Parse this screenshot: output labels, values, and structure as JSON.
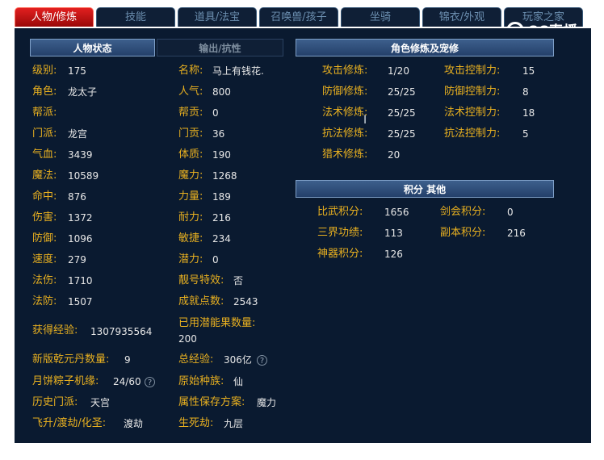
{
  "tabs": [
    "人物/修炼",
    "技能",
    "道具/法宝",
    "召唤兽/孩子",
    "坐骑",
    "锦衣/外观",
    "玩家之家"
  ],
  "logo": "CC直播",
  "headers": {
    "status": "人物状态",
    "output": "输出/抗性",
    "cultivation": "角色修炼及宠修",
    "points": "积分 其他"
  },
  "left": [
    {
      "label": "级别:",
      "value": "175"
    },
    {
      "label": "角色:",
      "value": "龙太子"
    },
    {
      "label": "帮派:",
      "value": ""
    },
    {
      "label": "门派:",
      "value": "龙宫"
    },
    {
      "label": "气血:",
      "value": "3439"
    },
    {
      "label": "魔法:",
      "value": "10589"
    },
    {
      "label": "命中:",
      "value": "876"
    },
    {
      "label": "伤害:",
      "value": "1372"
    },
    {
      "label": "防御:",
      "value": "1096"
    },
    {
      "label": "速度:",
      "value": "279"
    },
    {
      "label": "法伤:",
      "value": "1710"
    },
    {
      "label": "法防:",
      "value": "1507"
    }
  ],
  "mid": [
    {
      "label": "名称:",
      "value": "马上有钱花."
    },
    {
      "label": "人气:",
      "value": "800"
    },
    {
      "label": "帮贡:",
      "value": "0"
    },
    {
      "label": "门贡:",
      "value": "36"
    },
    {
      "label": "体质:",
      "value": "190"
    },
    {
      "label": "魔力:",
      "value": "1268"
    },
    {
      "label": "力量:",
      "value": "189"
    },
    {
      "label": "耐力:",
      "value": "216"
    },
    {
      "label": "敏捷:",
      "value": "234"
    },
    {
      "label": "潜力:",
      "value": "0"
    },
    {
      "label": "靓号特效:",
      "value": "否"
    },
    {
      "label": "成就点数:",
      "value": "2543"
    }
  ],
  "bottom": {
    "exp": {
      "label": "获得经验:",
      "value": "1307935564"
    },
    "fruit_label": "已用潜能果数量:",
    "fruit_value": "200",
    "qian": {
      "label": "新版乾元丹数量:",
      "value": "9"
    },
    "total": {
      "label": "总经验:",
      "value": "306亿"
    },
    "yuebing": {
      "label": "月饼粽子机缘:",
      "value": "24/60"
    },
    "race": {
      "label": "原始种族:",
      "value": "仙"
    },
    "history": {
      "label": "历史门派:",
      "value": "天宫"
    },
    "scheme": {
      "label": "属性保存方案:",
      "value": "魔力"
    },
    "feisheng": {
      "label": "飞升/渡劫/化圣:",
      "value": "渡劫"
    },
    "shengsi": {
      "label": "生死劫:",
      "value": "九层"
    }
  },
  "cultivation": [
    {
      "label": "攻击修炼:",
      "value": "1/20",
      "label2": "攻击控制力:",
      "value2": "15"
    },
    {
      "label": "防御修炼:",
      "value": "25/25",
      "label2": "防御控制力:",
      "value2": "8"
    },
    {
      "label": "法术修炼:",
      "value": "25/25",
      "label2": "法术控制力:",
      "value2": "18"
    },
    {
      "label": "抗法修炼:",
      "value": "25/25",
      "label2": "抗法控制力:",
      "value2": "5"
    },
    {
      "label": "猎术修炼:",
      "value": "20",
      "label2": "",
      "value2": ""
    }
  ],
  "points": [
    {
      "label": "比武积分:",
      "value": "1656",
      "label2": "剑会积分:",
      "value2": "0"
    },
    {
      "label": "三界功绩:",
      "value": "113",
      "label2": "副本积分:",
      "value2": "216"
    },
    {
      "label": "神器积分:",
      "value": "126",
      "label2": "",
      "value2": ""
    }
  ],
  "help_icon": "?"
}
